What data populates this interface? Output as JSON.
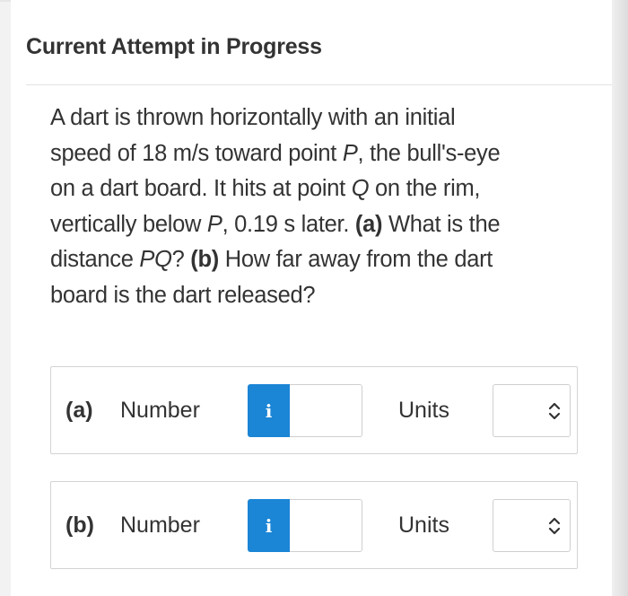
{
  "header": {
    "title": "Current Attempt in Progress"
  },
  "question": {
    "line1": "A dart is thrown horizontally with an initial",
    "line2": "speed of 18 m/s toward point ",
    "point_p": "P",
    "line2_end": ", the bull's-eye",
    "line3": "on a dart board. It hits at point ",
    "point_q": "Q",
    "line3_end": " on the rim,",
    "line4_start": "vertically below ",
    "point_p2": "P",
    "line4_mid": ", 0.19 s later. ",
    "part_a_marker": "(a)",
    "line4_end": " What is the",
    "line5_start": "distance ",
    "pq": "PQ",
    "line5_mid": "? ",
    "part_b_marker": "(b)",
    "line5_end": " How far away from the dart",
    "line6": "board is the dart released?"
  },
  "answers": [
    {
      "part": "(a)",
      "number_label": "Number",
      "info_icon": "i",
      "number_value": "",
      "units_label": "Units",
      "units_value": ""
    },
    {
      "part": "(b)",
      "number_label": "Number",
      "info_icon": "i",
      "number_value": "",
      "units_label": "Units",
      "units_value": ""
    }
  ],
  "colors": {
    "info_button": "#1b85d6",
    "text": "#333333",
    "border": "#d3d3d3"
  },
  "icons": {
    "info": "info-icon",
    "select": "chevron-up-down-icon"
  }
}
